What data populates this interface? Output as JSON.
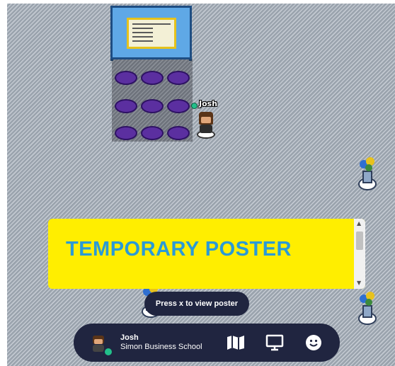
{
  "player": {
    "name": "Josh",
    "organization": "Simon Business School",
    "status": "online"
  },
  "poster": {
    "title": "TEMPORARY POSTER"
  },
  "prompt": {
    "text": "Press x to view poster"
  },
  "toolbar": {
    "buttons": [
      {
        "icon": "map-icon"
      },
      {
        "icon": "screen-share-icon"
      },
      {
        "icon": "emoji-icon"
      }
    ]
  },
  "colors": {
    "panel": "#202540",
    "poster_bg": "#ffee00",
    "poster_text": "#2a9ad6",
    "status_online": "#22c08a",
    "seat": "#5b2fa0"
  }
}
